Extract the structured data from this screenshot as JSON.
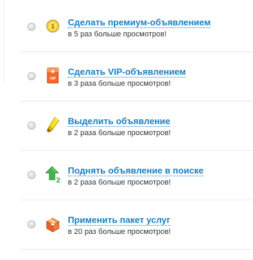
{
  "options": [
    {
      "title": "Сделать премиум-объявлением",
      "subtitle": "в 5 раз больше просмотров!",
      "icon": "premium-coin-icon"
    },
    {
      "title": "Сделать VIP-объявлением",
      "subtitle": "в 3 раза больше просмотров!",
      "icon": "vip-badge-icon"
    },
    {
      "title": "Выделить объявление",
      "subtitle": "в 2 раза больше просмотров!",
      "icon": "highlighter-icon"
    },
    {
      "title": "Поднять объявление в поиске",
      "subtitle": "в 2 раза больше просмотров!",
      "icon": "raise-arrow-icon"
    },
    {
      "title": "Применить пакет услуг",
      "subtitle": "в 20 раз больше просмотров!",
      "icon": "gift-box-icon"
    }
  ],
  "icon_labels": {
    "coin": "1",
    "vip": "VIP",
    "raise": "2"
  },
  "colors": {
    "link": "#1a7fc1",
    "text": "#333333",
    "divider": "#e9e9e9"
  }
}
